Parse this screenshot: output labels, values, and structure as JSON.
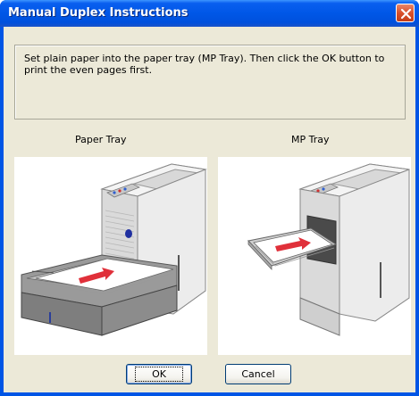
{
  "window": {
    "title": "Manual Duplex Instructions"
  },
  "message": "Set plain paper into the paper tray (MP Tray). Then click the OK button to print the even pages first.",
  "images": {
    "left_label": "Paper Tray",
    "right_label": "MP Tray"
  },
  "buttons": {
    "ok": "OK",
    "cancel": "Cancel"
  },
  "colors": {
    "titlebar": "#0058e6",
    "client_bg": "#ece9d8",
    "close_button": "#d8502b",
    "arrow": "#e0303a"
  },
  "icons": [
    "close-icon"
  ]
}
